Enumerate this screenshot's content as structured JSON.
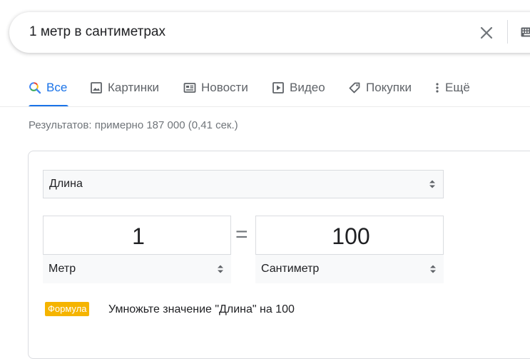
{
  "search": {
    "query": "1 метр в сантиметрах"
  },
  "tabs": [
    {
      "label": "Все",
      "active": true,
      "icon": "search-icon"
    },
    {
      "label": "Картинки",
      "icon": "image-icon"
    },
    {
      "label": "Новости",
      "icon": "news-icon"
    },
    {
      "label": "Видео",
      "icon": "video-icon"
    },
    {
      "label": "Покупки",
      "icon": "tag-icon"
    },
    {
      "label": "Ещё",
      "icon": "more-vert-icon"
    }
  ],
  "results_count": "Результатов: примерно 187 000 (0,41 сек.)",
  "converter": {
    "quantity": "Длина",
    "from_value": "1",
    "from_unit": "Метр",
    "equals": "=",
    "to_value": "100",
    "to_unit": "Сантиметр",
    "formula_label": "Формула",
    "formula_text": "Умножьте значение \"Длина\" на 100"
  },
  "colors": {
    "accent": "#1a73e8",
    "formula_badge": "#f5b400"
  }
}
